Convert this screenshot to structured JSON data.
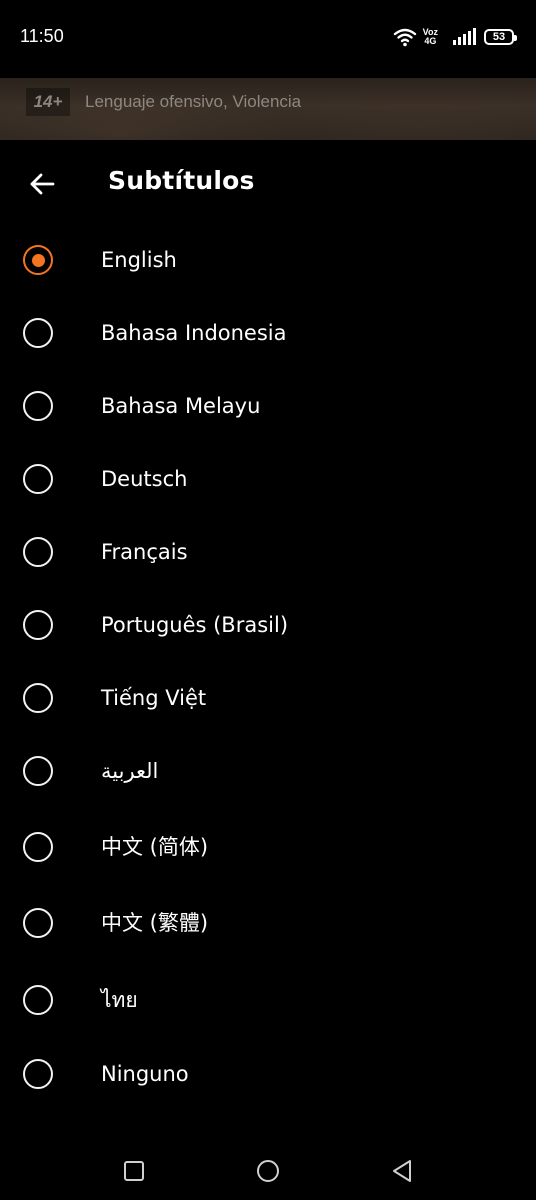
{
  "status_bar": {
    "time": "11:50",
    "network_voz": "Voz",
    "network_gen": "4G",
    "battery": "53",
    "battery_level": 0.53
  },
  "rating": {
    "badge": "14+",
    "descriptors": "Lenguaje ofensivo, Violencia"
  },
  "header": {
    "title": "Subtítulos",
    "back_icon": "arrow-left-icon"
  },
  "subtitles": {
    "selected": "English",
    "accent_color": "#f47521",
    "options": [
      {
        "label": "English",
        "selected": true
      },
      {
        "label": "Bahasa Indonesia",
        "selected": false
      },
      {
        "label": "Bahasa Melayu",
        "selected": false
      },
      {
        "label": "Deutsch",
        "selected": false
      },
      {
        "label": "Français",
        "selected": false
      },
      {
        "label": "Português (Brasil)",
        "selected": false
      },
      {
        "label": "Tiếng Việt",
        "selected": false
      },
      {
        "label": "العربية",
        "selected": false
      },
      {
        "label": "中文 (简体)",
        "selected": false
      },
      {
        "label": "中文 (繁體)",
        "selected": false
      },
      {
        "label": "ไทย",
        "selected": false
      },
      {
        "label": "Ninguno",
        "selected": false
      }
    ]
  },
  "nav_bar": {
    "icons": [
      "square-recents-icon",
      "circle-home-icon",
      "triangle-back-icon"
    ]
  }
}
